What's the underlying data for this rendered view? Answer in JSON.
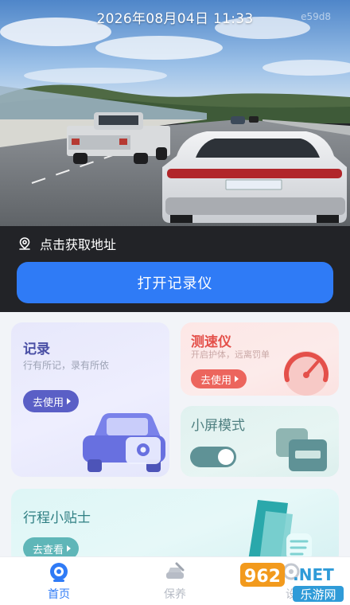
{
  "camera": {
    "timestamp": "2026年08月04日 11:33",
    "corner_mark": "e59d8"
  },
  "location": {
    "label": "点击获取地址",
    "icon": "location-pin-icon"
  },
  "record_button": {
    "label": "打开记录仪"
  },
  "cards": {
    "record": {
      "title": "记录",
      "subtitle": "行有所记，录有所依",
      "button": "去使用",
      "icon": "car-camera-icon"
    },
    "speedometer": {
      "title": "测速仪",
      "subtitle": "开启护体，远离罚单",
      "button": "去使用",
      "icon": "speedometer-icon"
    },
    "small_screen": {
      "title": "小屏模式",
      "toggle_on": true,
      "icon": "windows-icon"
    },
    "tips": {
      "title": "行程小贴士",
      "button": "去查看",
      "icon": "book-icon"
    }
  },
  "nav": {
    "home": "首页",
    "care": "保养",
    "third": "设"
  },
  "watermark": {
    "number": "962",
    "net": ".NET",
    "cn": "乐游网"
  },
  "colors": {
    "primary": "#2f7bf6",
    "record_title": "#4a4fa5",
    "speed_title": "#e4504a",
    "small_title": "#4e7f80",
    "tips_title": "#2f7f83"
  }
}
